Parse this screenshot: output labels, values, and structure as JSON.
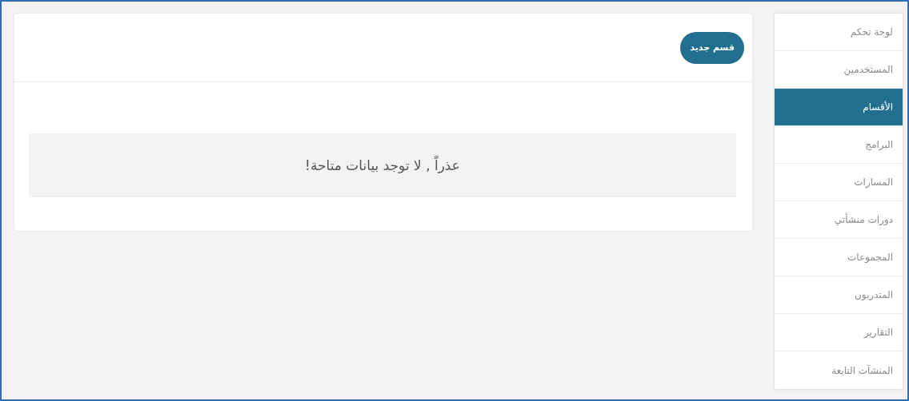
{
  "sidebar": {
    "items": [
      {
        "label": "لوحة تحكم",
        "selected": false
      },
      {
        "label": "المستخدمين",
        "selected": false
      },
      {
        "label": "الأقسام",
        "selected": true
      },
      {
        "label": "البرامج",
        "selected": false
      },
      {
        "label": "المسارات",
        "selected": false
      },
      {
        "label": "دورات منشأتي",
        "selected": false
      },
      {
        "label": "المجموعات",
        "selected": false
      },
      {
        "label": "المتدربون",
        "selected": false
      },
      {
        "label": "التقارير",
        "selected": false
      },
      {
        "label": "المنشآت التابعة",
        "selected": false
      }
    ]
  },
  "main": {
    "new_button": "قسم جديد",
    "empty_message": "عذراً , لا توجد بيانات متاحة!"
  }
}
